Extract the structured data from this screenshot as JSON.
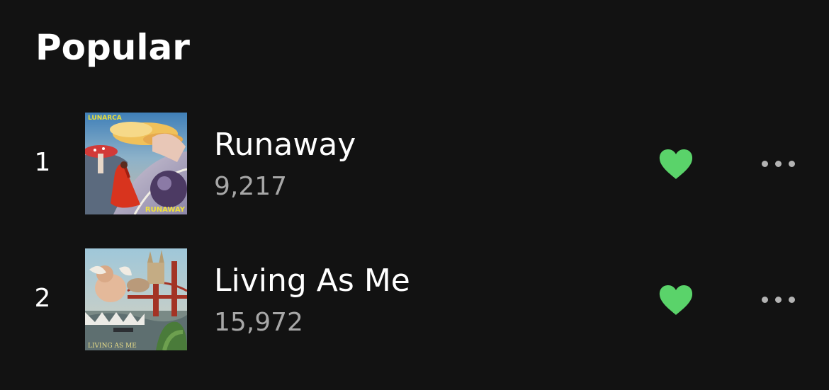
{
  "section": {
    "title": "Popular"
  },
  "tracks": [
    {
      "rank": "1",
      "title": "Runaway",
      "plays": "9,217",
      "liked": true,
      "artwork": {
        "top_text": "LUNARCA",
        "bottom_text": "RUNAWAY"
      }
    },
    {
      "rank": "2",
      "title": "Living As Me",
      "plays": "15,972",
      "liked": true,
      "artwork": {
        "top_text": "",
        "bottom_text": "LIVING AS ME"
      }
    }
  ],
  "colors": {
    "background": "#121212",
    "accent_green": "#1ed760",
    "heart_green": "#5ad36a",
    "secondary_text": "#a7a7a7"
  },
  "icons": {
    "like": "heart-icon",
    "more": "more-options-icon"
  }
}
